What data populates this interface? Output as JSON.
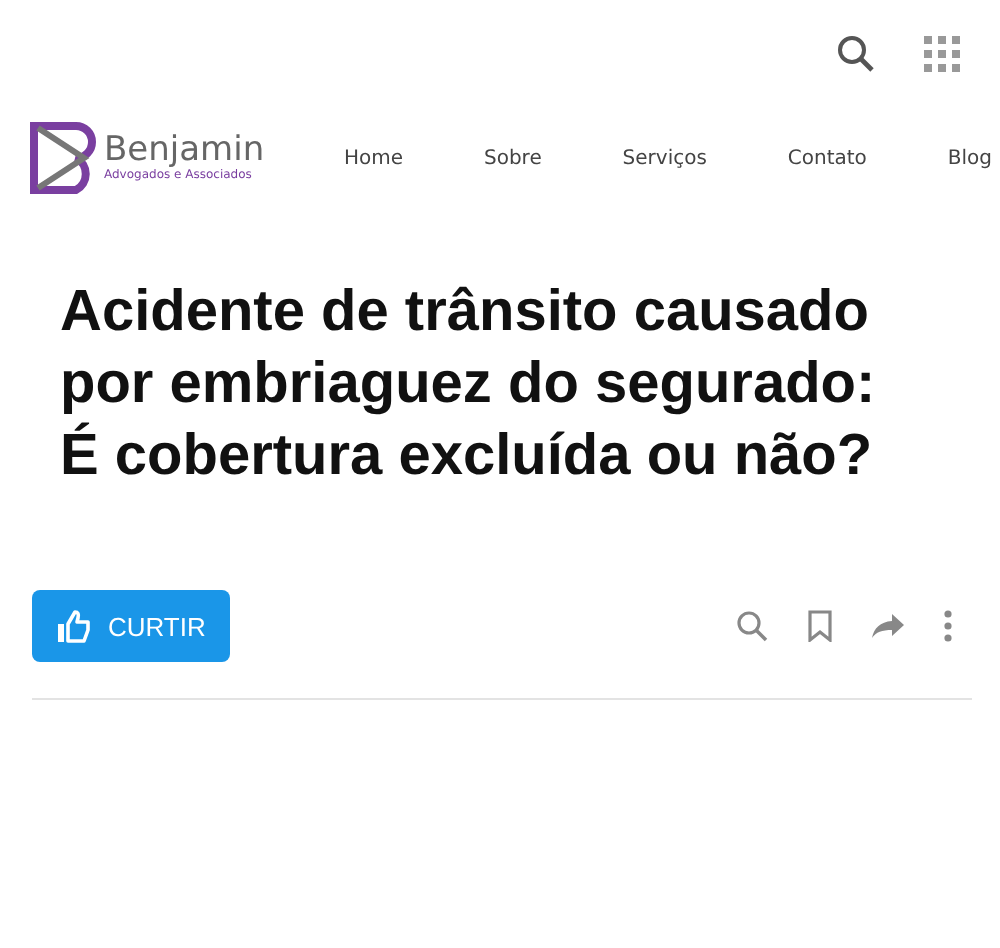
{
  "brand": {
    "name": "Benjamin",
    "tagline": "Advogados e Associados"
  },
  "nav": [
    {
      "label": "Home"
    },
    {
      "label": "Sobre"
    },
    {
      "label": "Serviços"
    },
    {
      "label": "Contato"
    },
    {
      "label": "Blog"
    }
  ],
  "article": {
    "title": "Acidente de trânsito causado por embriaguez do segurado: É cobertura excluída ou não?"
  },
  "like_button": {
    "label": "CURTIR"
  }
}
